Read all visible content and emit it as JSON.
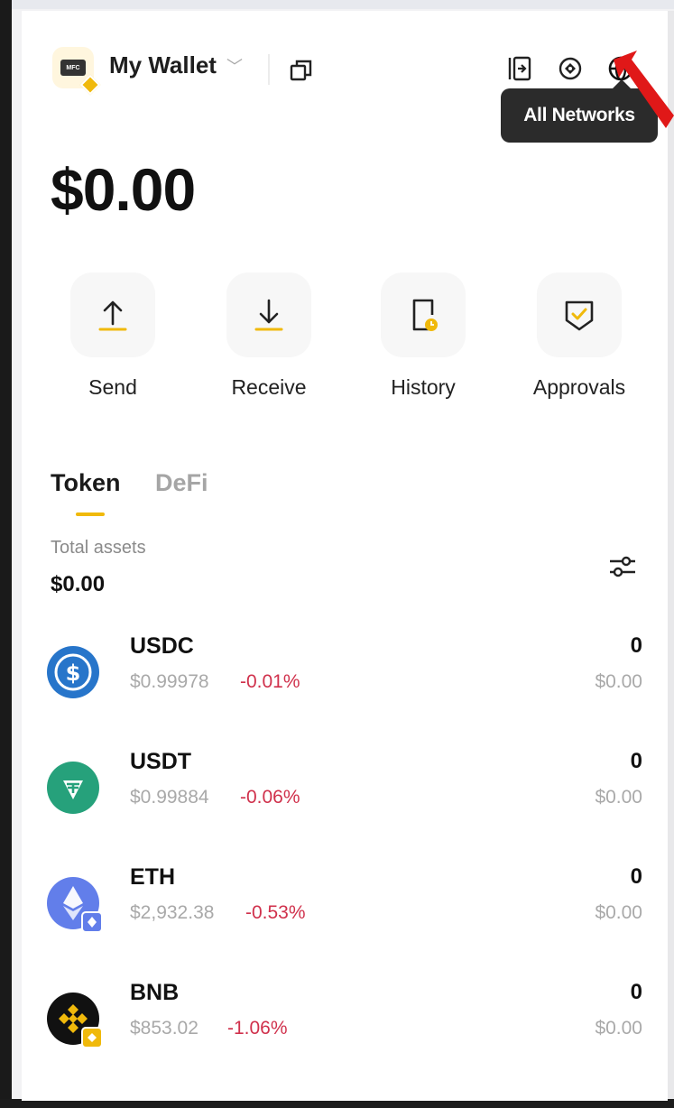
{
  "wallet": {
    "logo_text": "MFC",
    "name": "My Wallet"
  },
  "header": {
    "tooltip": "All Networks"
  },
  "balance": "$0.00",
  "actions": [
    {
      "label": "Send"
    },
    {
      "label": "Receive"
    },
    {
      "label": "History"
    },
    {
      "label": "Approvals"
    }
  ],
  "tabs": [
    {
      "label": "Token",
      "active": true
    },
    {
      "label": "DeFi",
      "active": false
    }
  ],
  "assets": {
    "total_label": "Total assets",
    "total_value": "$0.00"
  },
  "tokens": [
    {
      "symbol": "USDC",
      "price": "$0.99978",
      "change": "-0.01%",
      "amount": "0",
      "value": "$0.00",
      "color": "#2775ca"
    },
    {
      "symbol": "USDT",
      "price": "$0.99884",
      "change": "-0.06%",
      "amount": "0",
      "value": "$0.00",
      "color": "#26a17b"
    },
    {
      "symbol": "ETH",
      "price": "$2,932.38",
      "change": "-0.53%",
      "amount": "0",
      "value": "$0.00",
      "color": "#627eea"
    },
    {
      "symbol": "BNB",
      "price": "$853.02",
      "change": "-1.06%",
      "amount": "0",
      "value": "$0.00",
      "color": "#f0b90b"
    }
  ],
  "colors": {
    "accent": "#f0b90b",
    "negative": "#d0314c",
    "tooltip_bg": "#2b2b2b",
    "annotation_arrow": "#e01818"
  },
  "icons": {
    "header": [
      "copy-icon",
      "sidebar-panel-icon",
      "compass-icon",
      "globe-icon"
    ],
    "actions": [
      "send-arrow-up-icon",
      "receive-arrow-down-icon",
      "history-clock-icon",
      "approvals-shield-icon"
    ],
    "filter": "filter-sliders-icon"
  }
}
